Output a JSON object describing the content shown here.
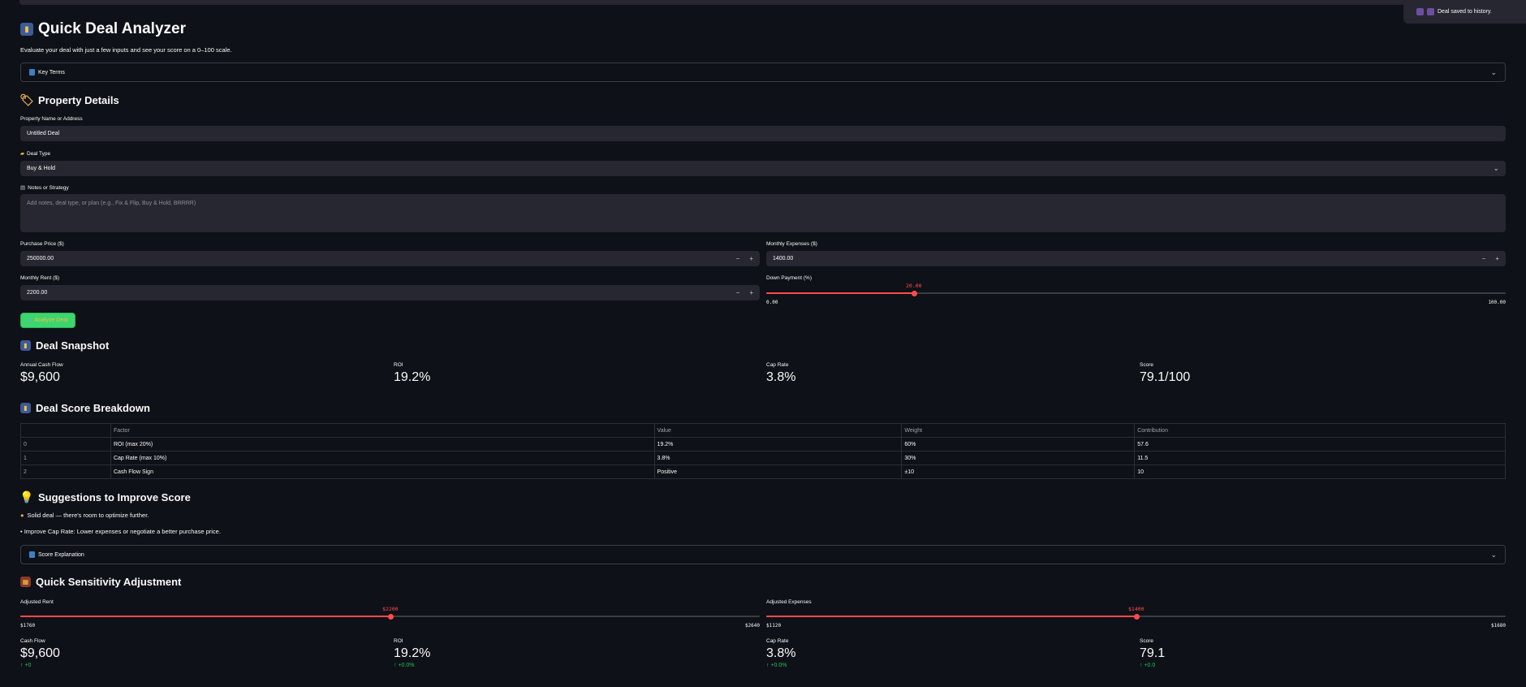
{
  "toast": {
    "icon": "floppy-disk-icon",
    "text": "Deal saved to history."
  },
  "header": {
    "title": "Quick Deal Analyzer",
    "subtitle": "Evaluate your deal with just a few inputs and see your score on a 0–100 scale."
  },
  "key_terms": {
    "label": "Key Terms"
  },
  "property": {
    "heading": "Property Details",
    "name_label": "Property Name or Address",
    "name_value": "Untitled Deal",
    "deal_type_label": "Deal Type",
    "deal_type_value": "Buy & Hold",
    "notes_label": "Notes or Strategy",
    "notes_placeholder": "Add notes, deal type, or plan (e.g., Fix & Flip, Buy & Hold, BRRRR)",
    "purchase_label": "Purchase Price ($)",
    "purchase_value": "250000.00",
    "expenses_label": "Monthly Expenses ($)",
    "expenses_value": "1400.00",
    "rent_label": "Monthly Rent ($)",
    "rent_value": "2200.00",
    "down_label": "Down Payment (%)",
    "down_value": "20.00",
    "down_min": "0.00",
    "down_max": "100.00",
    "down_fraction": 0.2,
    "minus": "−",
    "plus": "+"
  },
  "analyze_button": {
    "icon": "magnifier-icon",
    "label": "Analyze Deal"
  },
  "snapshot": {
    "heading": "Deal Snapshot",
    "metrics": [
      {
        "label": "Annual Cash Flow",
        "value": "$9,600"
      },
      {
        "label": "ROI",
        "value": "19.2%"
      },
      {
        "label": "Cap Rate",
        "value": "3.8%"
      },
      {
        "label": "Score",
        "value": "79.1/100"
      }
    ]
  },
  "breakdown": {
    "heading": "Deal Score Breakdown",
    "columns": [
      "",
      "Factor",
      "Value",
      "Weight",
      "Contribution"
    ],
    "rows": [
      [
        "0",
        "ROI (max 20%)",
        "19.2%",
        "60%",
        "57.6"
      ],
      [
        "1",
        "Cap Rate (max 10%)",
        "3.8%",
        "30%",
        "11.5"
      ],
      [
        "2",
        "Cash Flow Sign",
        "Positive",
        "±10",
        "10"
      ]
    ]
  },
  "suggestions": {
    "heading": "Suggestions to Improve Score",
    "line1": "Solid deal — there's room to optimize further.",
    "line2": "• Improve Cap Rate: Lower expenses or negotiate a better purchase price."
  },
  "score_explanation": {
    "label": "Score Explanation"
  },
  "sensitivity": {
    "heading": "Quick Sensitivity Adjustment",
    "rent_label": "Adjusted Rent",
    "rent_value": "$2200",
    "rent_min": "$1760",
    "rent_max": "$2640",
    "rent_fraction": 0.5,
    "exp_label": "Adjusted Expenses",
    "exp_value": "$1400",
    "exp_min": "$1120",
    "exp_max": "$1680",
    "exp_fraction": 0.5,
    "metrics": [
      {
        "label": "Cash Flow",
        "value": "$9,600",
        "delta": "+0"
      },
      {
        "label": "ROI",
        "value": "19.2%",
        "delta": "+0.0%"
      },
      {
        "label": "Cap Rate",
        "value": "3.8%",
        "delta": "+0.0%"
      },
      {
        "label": "Score",
        "value": "79.1",
        "delta": "+0.0"
      }
    ]
  }
}
